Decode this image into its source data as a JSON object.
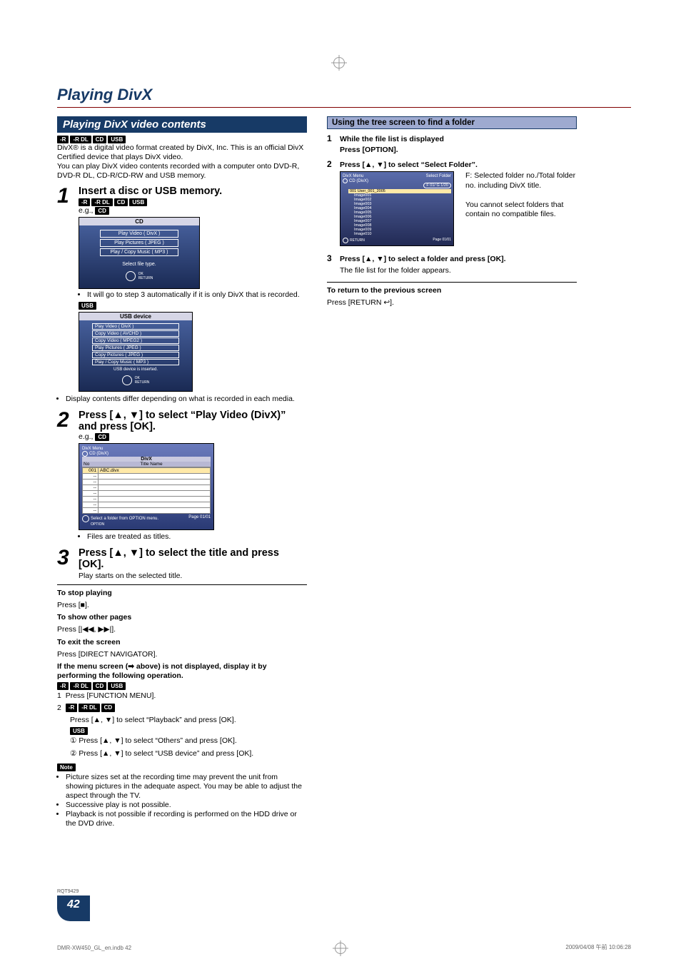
{
  "page_title": "Playing DivX",
  "left": {
    "section_bar": "Playing DivX video contents",
    "media_tags_top": [
      "-R",
      "-R DL",
      "CD",
      "USB"
    ],
    "intro_p1": "DivX® is a digital video format created by DivX, Inc. This is an official DivX Certified device that plays DivX video.",
    "intro_p2": "You can play DivX video contents recorded with a computer onto DVD-R, DVD-R DL, CD-R/CD-RW and USB memory.",
    "step1": {
      "num": "1",
      "head": "Insert a disc or USB memory.",
      "media_tags": [
        "-R",
        "-R DL",
        "CD",
        "USB"
      ],
      "eg": "e.g., ",
      "eg_tag": "CD",
      "scr_header": "CD",
      "scr_btns": [
        "Play Video ( DivX )",
        "Play Pictures ( JPEG )",
        "Play / Copy Music ( MP3 )"
      ],
      "scr_caption": "Select file type.",
      "scr_ok": "OK",
      "scr_return": "RETURN",
      "bullet1": "It will go to step 3 automatically if it is only DivX that is recorded.",
      "usb_tag": "USB",
      "usb_header": "USB device",
      "usb_btns": [
        "Play Video ( DivX )",
        "Copy Video ( AVCHD )",
        "Copy Video ( MPEG2 )",
        "Play Pictures ( JPEG )",
        "Copy Pictures ( JPEG )",
        "Play / Copy Music ( MP3 )"
      ],
      "usb_caption": "USB device is inserted.",
      "bullet2": "Display contents differ depending on what is recorded in each media."
    },
    "step2": {
      "num": "2",
      "head": "Press [▲, ▼] to select “Play Video (DivX)” and press [OK].",
      "eg": "e.g., ",
      "eg_tag": "CD",
      "list_title_top": "DivX Menu",
      "list_media": "CD (DivX)",
      "list_header": "DivX",
      "list_cols": [
        "No",
        "Title Name"
      ],
      "list_first": "ABC.divx",
      "list_row_count": 8,
      "list_foot_left": "Select a folder from OPTION menu.",
      "list_foot_right": "Page 01/01",
      "list_foot_option": "OPTION",
      "bullet": "Files are treated as titles."
    },
    "step3": {
      "num": "3",
      "head": "Press [▲, ▼] to select the title and press [OK].",
      "sub": "Play starts on the selected title."
    },
    "post": {
      "stop_head": "To stop playing",
      "stop_body": "Press [■].",
      "pages_head": "To show other pages",
      "pages_body": "Press [|◀◀, ▶▶|].",
      "exit_head": "To exit the screen",
      "exit_body": "Press [DIRECT NAVIGATOR].",
      "menu_head": "If the menu screen (➡ above) is not displayed, display it by performing the following operation.",
      "menu_tags": [
        "-R",
        "-R DL",
        "CD",
        "USB"
      ],
      "menu_1": "Press [FUNCTION MENU].",
      "menu_2_tags": [
        "-R",
        "-R DL",
        "CD"
      ],
      "menu_2_body": "Press [▲, ▼] to select “Playback” and press [OK].",
      "menu_usb_tag": "USB",
      "menu_usb_1": "① Press [▲, ▼] to select “Others” and press [OK].",
      "menu_usb_2": "② Press [▲, ▼] to select “USB device” and press [OK].",
      "note_label": "Note",
      "note_1": "Picture sizes set at the recording time may prevent the unit from showing pictures in the adequate aspect. You may be able to adjust the aspect through the TV.",
      "note_2": "Successive play is not possible.",
      "note_3": "Playback is not possible if recording is performed on the HDD drive or the DVD drive."
    }
  },
  "right": {
    "sub_bar": "Using the tree screen to find a folder",
    "s1_num": "1",
    "s1_l1": "While the file list is displayed",
    "s1_l2": "Press [OPTION].",
    "s2_num": "2",
    "s2_head": "Press [▲, ▼] to select “Select Folder”.",
    "tree_title": "DivX Menu",
    "tree_media": "CD (DivX)",
    "tree_opt": "Select Folder",
    "tree_badge": "F 01/ G 1/20",
    "tree_items": [
      "001 User_001_2005",
      "Image001",
      "Image002",
      "Image003",
      "Image004",
      "Image005",
      "Image006",
      "Image007",
      "Image008",
      "Image009",
      "Image010"
    ],
    "tree_page": "Page 01/01",
    "tree_note1": "F: Selected folder no./Total folder no. including DivX title.",
    "tree_note2": "You cannot select folders that contain no compatible files.",
    "s3_num": "3",
    "s3_head": "Press [▲, ▼] to select a folder and press [OK].",
    "s3_sub": "The file list for the folder appears.",
    "ret_head": "To return to the previous screen",
    "ret_body": "Press [RETURN ↩]."
  },
  "footer": {
    "code": "RQT9429",
    "page_num": "42",
    "left": "DMR-XW450_GL_en.indb   42",
    "right": "2009/04/08   午前 10:06:28"
  }
}
